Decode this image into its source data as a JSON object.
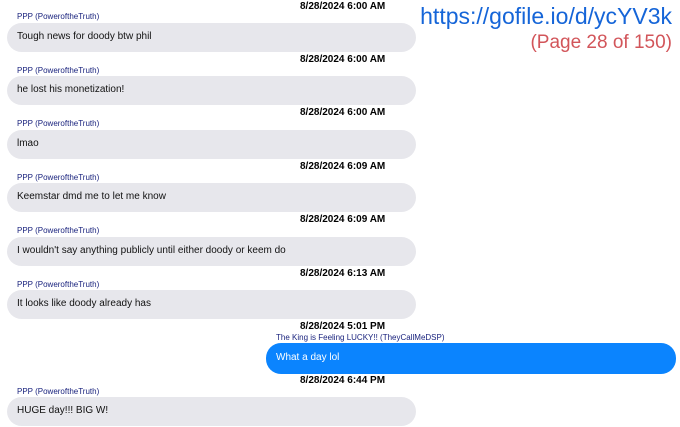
{
  "overlay": {
    "link": "https://gofile.io/d/ycYV3k",
    "page_indicator": "(Page 28 of 150)"
  },
  "messages": [
    {
      "timestamp": "8/28/2024 6:00 AM",
      "sender": "PPP (PoweroftheTruth)",
      "text": "Tough news for doody btw phil",
      "direction": "incoming"
    },
    {
      "timestamp": "8/28/2024 6:00 AM",
      "sender": "PPP (PoweroftheTruth)",
      "text": "he lost his monetization!",
      "direction": "incoming"
    },
    {
      "timestamp": "8/28/2024 6:00 AM",
      "sender": "PPP (PoweroftheTruth)",
      "text": "lmao",
      "direction": "incoming"
    },
    {
      "timestamp": "8/28/2024 6:09 AM",
      "sender": "PPP (PoweroftheTruth)",
      "text": "Keemstar dmd me to let me know",
      "direction": "incoming"
    },
    {
      "timestamp": "8/28/2024 6:09 AM",
      "sender": "PPP (PoweroftheTruth)",
      "text": "I wouldn't say anything publicly until either doody or keem do",
      "direction": "incoming"
    },
    {
      "timestamp": "8/28/2024 6:13 AM",
      "sender": "PPP (PoweroftheTruth)",
      "text": "It looks like doody already has",
      "direction": "incoming"
    },
    {
      "timestamp": "8/28/2024 5:01 PM",
      "sender": "The King is Feeling LUCKY!! (TheyCallMeDSP)",
      "text": "What a day lol",
      "direction": "outgoing"
    },
    {
      "timestamp": "8/28/2024 6:44 PM",
      "sender": "PPP (PoweroftheTruth)",
      "text": "HUGE day!!! BIG W!",
      "direction": "incoming"
    }
  ],
  "colors": {
    "incoming_bubble": "#e7e7ec",
    "outgoing_bubble": "#0b84fe",
    "sender_name": "#1a237e",
    "link": "#1565d8",
    "page_indicator": "#d2555a"
  }
}
